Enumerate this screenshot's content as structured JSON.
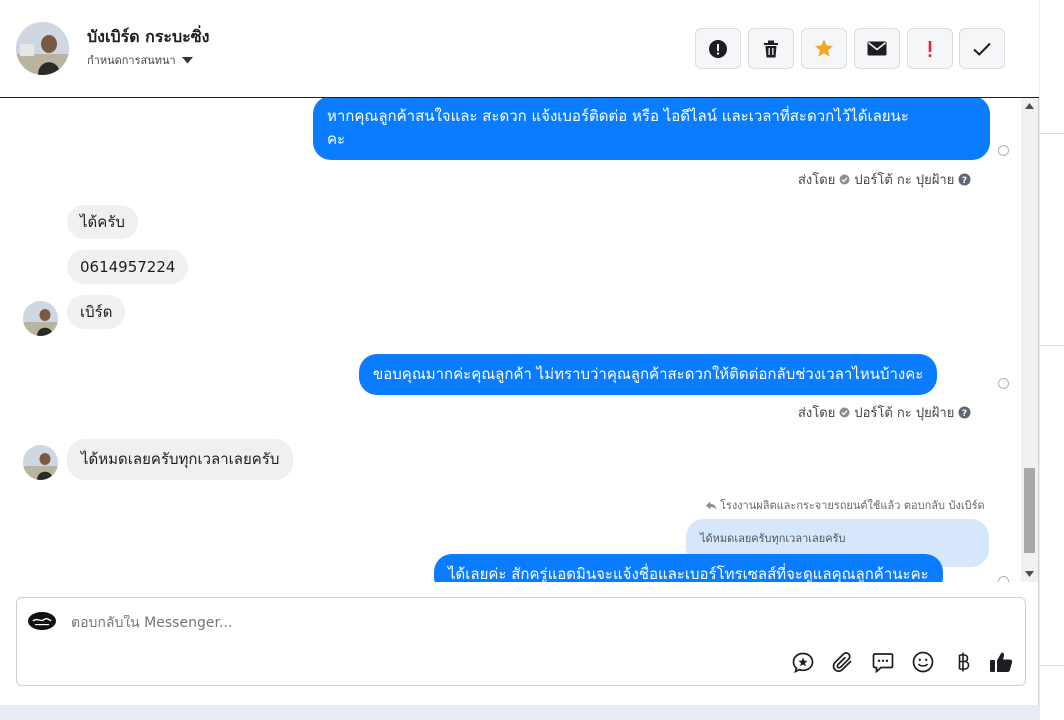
{
  "header": {
    "name": "บังเบิร์ด กระบะซิ่ง",
    "subtitle": "กำหนดการสนทนา",
    "actions": [
      {
        "name": "spam-button",
        "icon": "alert-circle-icon"
      },
      {
        "name": "delete-button",
        "icon": "trash-icon"
      },
      {
        "name": "star-button",
        "icon": "star-icon"
      },
      {
        "name": "mark-unread-button",
        "icon": "envelope-icon"
      },
      {
        "name": "follow-up-button",
        "icon": "exclamation-icon"
      },
      {
        "name": "mark-done-button",
        "icon": "checkmark-icon"
      }
    ]
  },
  "messages": {
    "m1_line1": "หากคุณลูกค้าสนใจและ สะดวก แจ้งเบอร์ติดต่อ หรือ ไอดีไลน์ และเวลาที่สะดวกไว้ได้เลยนะ",
    "m1_line2": "คะ",
    "sent_by_label": "ส่งโดย",
    "sent_by_name": "ปอร์โต้ กะ ปุยฝ้าย",
    "m2": "ได้ครับ",
    "m3": "0614957224",
    "m4": "เบิร์ด",
    "m5": "ขอบคุณมากค่ะคุณลูกค้า ไม่ทราบว่าคุณลูกค้าสะดวกให้ติดต่อกลับช่วงเวลาไหนบ้างคะ",
    "sent_by_name_2": "ปอร์โต้ กะ ปุยฝ้าย",
    "m6": "ได้หมดเลยครับทุกเวลาเลยครับ",
    "reply_context": "โรงงานผลิตและกระจายรถยนต์ใช้แล้ว ตอบกลับ บังเบิร์ด",
    "quoted": "ได้หมดเลยครับทุกเวลาเลยครับ",
    "m7": "ได้เลยค่ะ สักครู่แอดมินจะแจ้งชื่อและเบอร์โทรเซลส์ที่จะดูแลคุณลูกค้านะคะ"
  },
  "composer": {
    "placeholder": "ตอบกลับใน Messenger..."
  },
  "colors": {
    "outgoing_bubble": "#0a7cff",
    "incoming_bubble": "#f0f0f0",
    "quoted_bubble": "#d6e6fb",
    "star": "#f5a623",
    "alert": "#e41e3f"
  }
}
